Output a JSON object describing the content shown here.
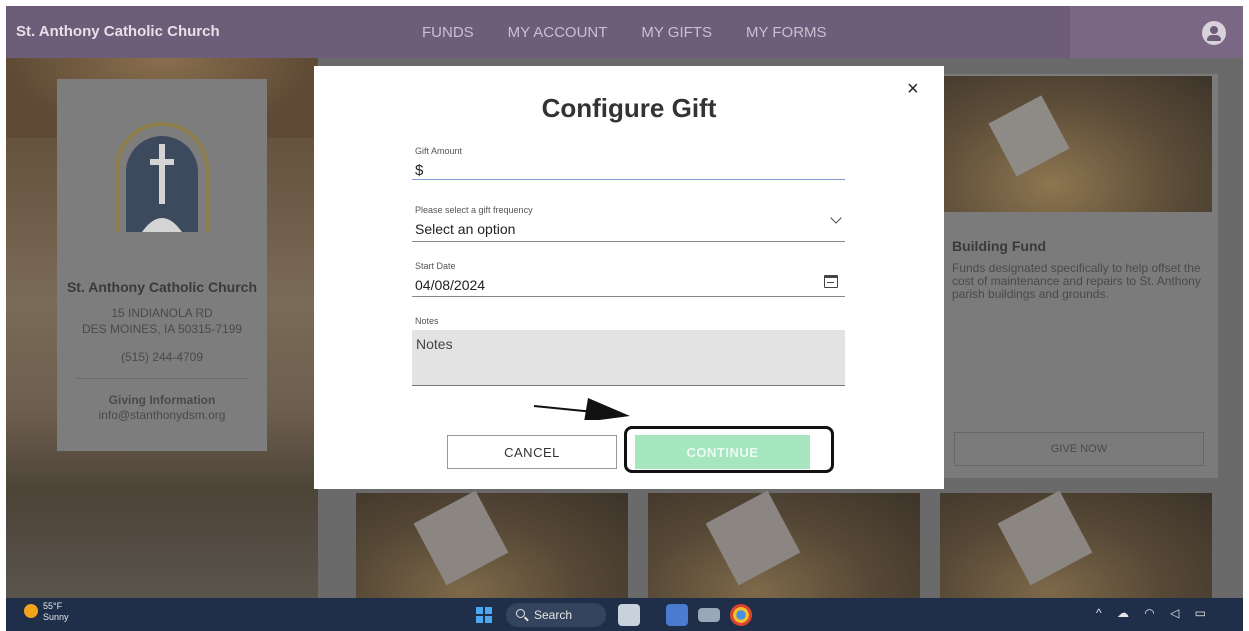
{
  "appbar": {
    "brand": "St. Anthony Catholic Church",
    "nav": [
      "FUNDS",
      "MY ACCOUNT",
      "MY GIFTS",
      "MY FORMS"
    ]
  },
  "church": {
    "name": "St. Anthony Catholic Church",
    "address_line1": "15 INDIANOLA RD",
    "address_line2": "DES MOINES, IA 50315-7199",
    "phone": "(515) 244-4709",
    "giving_title": "Giving Information",
    "giving_email": "info@stanthonydsm.org"
  },
  "fund": {
    "title": "Building Fund",
    "description": "Funds designated specifically to help offset the cost of maintenance and repairs to St. Anthony parish buildings and grounds.",
    "button": "GIVE NOW"
  },
  "modal": {
    "title": "Configure Gift",
    "close": "×",
    "amount_label": "Gift Amount",
    "amount_prefix": "$",
    "frequency_label": "Please select a gift frequency",
    "frequency_value": "Select an option",
    "start_label": "Start Date",
    "start_value": "04/08/2024",
    "notes_label": "Notes",
    "notes_placeholder": "Notes",
    "cancel": "CANCEL",
    "continue": "CONTINUE"
  },
  "taskbar": {
    "temperature": "55°F",
    "condition": "Sunny",
    "search": "Search"
  },
  "colors": {
    "appbar": "#6e5d78",
    "continue_button": "#a5e6bf",
    "taskbar": "#1f2f4a"
  }
}
